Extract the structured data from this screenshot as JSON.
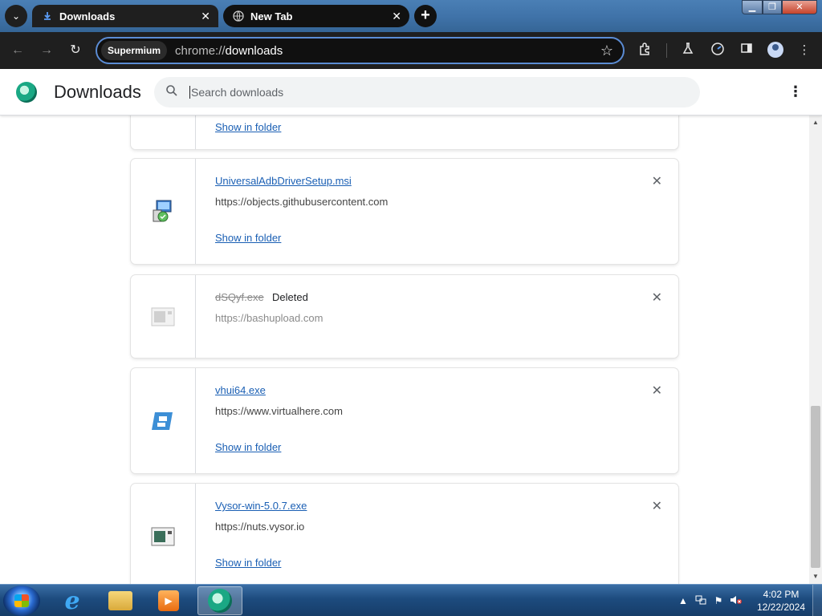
{
  "browser": {
    "tabs": [
      {
        "title": "Downloads",
        "active": true
      },
      {
        "title": "New Tab",
        "active": false
      }
    ],
    "omnibox": {
      "chip": "Supermium",
      "url_prefix": "chrome://",
      "url_path": "downloads"
    }
  },
  "downloads_page": {
    "title": "Downloads",
    "search_placeholder": "Search downloads",
    "items": [
      {
        "filename": "",
        "source": "",
        "action": "Show in folder"
      },
      {
        "filename": "UniversalAdbDriverSetup.msi",
        "source": "https://objects.githubusercontent.com",
        "action": "Show in folder",
        "icon": "installer-icon"
      },
      {
        "filename": "dSQyf.exe",
        "status": "Deleted",
        "source": "https://bashupload.com",
        "icon": "generic-exe-icon"
      },
      {
        "filename": "vhui64.exe",
        "source": "https://www.virtualhere.com",
        "action": "Show in folder",
        "icon": "virtualhere-icon"
      },
      {
        "filename": "Vysor-win-5.0.7.exe",
        "source": "https://nuts.vysor.io",
        "action": "Show in folder",
        "icon": "generic-exe-icon"
      }
    ]
  },
  "taskbar": {
    "apps": [
      "internet-explorer-icon",
      "folder-icon",
      "media-player-icon",
      "supermium-icon"
    ],
    "clock": {
      "time": "4:02 PM",
      "date": "12/22/2024"
    }
  },
  "colors": {
    "link": "#1a5fb4",
    "toolbar_bg": "#1f1f1f",
    "omnibox_border": "#5b8cd4"
  }
}
